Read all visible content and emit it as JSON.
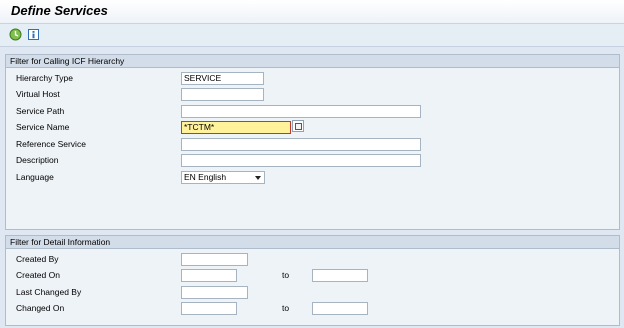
{
  "window": {
    "title": "Define Services"
  },
  "toolbar": {
    "execute_icon": "execute-clock-icon",
    "info_icon": "information-icon"
  },
  "panel_icf": {
    "heading": "Filter for Calling ICF Hierarchy",
    "hierarchy_type": {
      "label": "Hierarchy Type",
      "value": "SERVICE"
    },
    "virtual_host": {
      "label": "Virtual Host",
      "value": ""
    },
    "service_path": {
      "label": "Service Path",
      "value": ""
    },
    "service_name": {
      "label": "Service Name",
      "value": "*TCTM*"
    },
    "reference_service": {
      "label": "Reference Service",
      "value": ""
    },
    "description": {
      "label": "Description",
      "value": ""
    },
    "language": {
      "label": "Language",
      "value": "EN English"
    }
  },
  "panel_detail": {
    "heading": "Filter for Detail Information",
    "created_by": {
      "label": "Created By",
      "value": ""
    },
    "created_on": {
      "label": "Created On",
      "from": "",
      "to_label": "to",
      "to": ""
    },
    "last_changed_by": {
      "label": "Last Changed By",
      "value": ""
    },
    "changed_on": {
      "label": "Changed On",
      "from": "",
      "to_label": "to",
      "to": ""
    }
  },
  "colors": {
    "background": "#dfe8f2",
    "panel": "#eef3f8",
    "panel_header": "#d3dde9",
    "active_field": "#fff29a",
    "active_border": "#c0392b"
  }
}
